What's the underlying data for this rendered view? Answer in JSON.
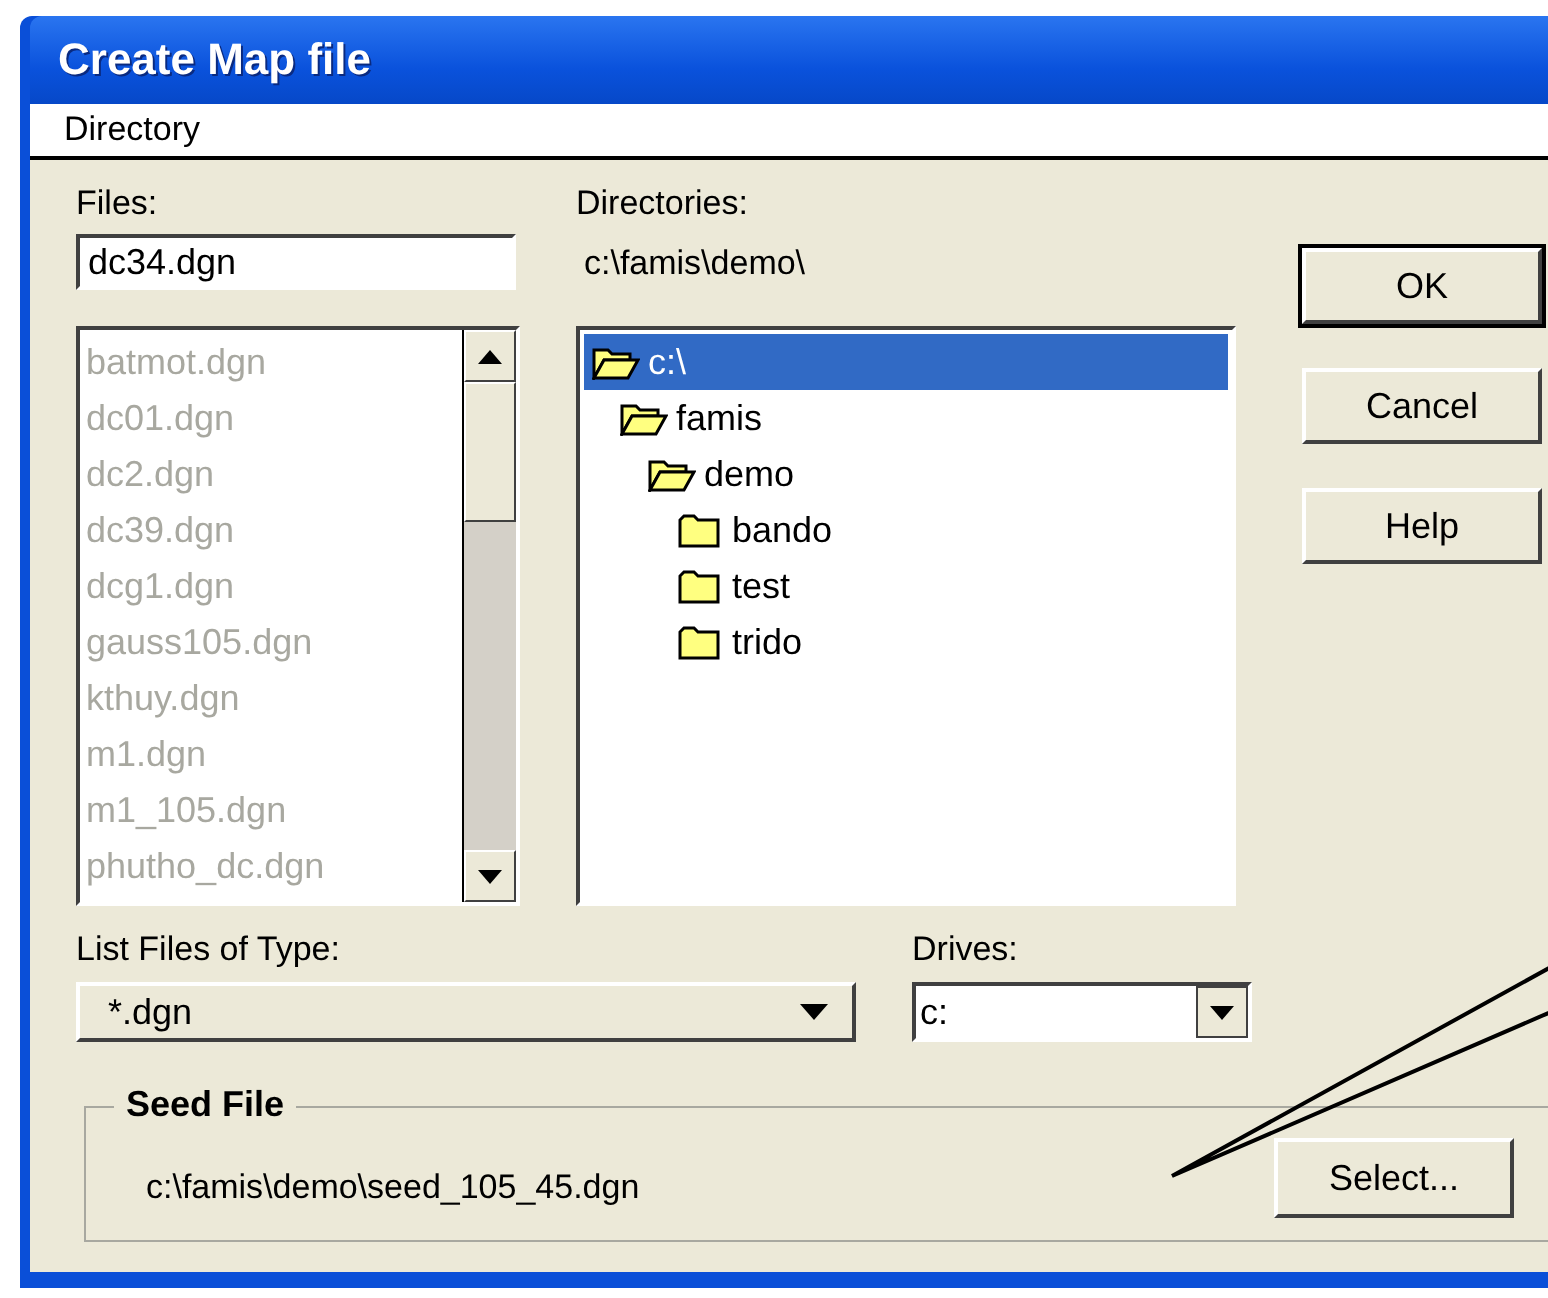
{
  "window": {
    "title": "Create Map file"
  },
  "menu": [
    {
      "label": "Directory"
    }
  ],
  "files": {
    "label": "Files:",
    "value": "dc34.dgn",
    "disabled": true,
    "items": [
      {
        "name": "batmot.dgn"
      },
      {
        "name": "dc01.dgn"
      },
      {
        "name": "dc2.dgn"
      },
      {
        "name": "dc39.dgn"
      },
      {
        "name": "dcg1.dgn"
      },
      {
        "name": "gauss105.dgn"
      },
      {
        "name": "kthuy.dgn"
      },
      {
        "name": "m1.dgn"
      },
      {
        "name": "m1_105.dgn"
      },
      {
        "name": "phutho_dc.dgn"
      }
    ]
  },
  "directories": {
    "label": "Directories:",
    "path": "c:\\famis\\demo\\",
    "tree": [
      {
        "name": "c:\\",
        "expanded": true,
        "selected": true,
        "children": [
          {
            "name": "famis",
            "expanded": true,
            "selected": false,
            "children": [
              {
                "name": "demo",
                "expanded": true,
                "selected": false,
                "children": [
                  {
                    "name": "bando",
                    "expanded": false,
                    "selected": false
                  },
                  {
                    "name": "test",
                    "expanded": false,
                    "selected": false
                  },
                  {
                    "name": "trido",
                    "expanded": false,
                    "selected": false
                  }
                ]
              }
            ]
          }
        ]
      }
    ]
  },
  "buttons": [
    {
      "label": "OK",
      "default": true
    },
    {
      "label": "Cancel",
      "default": false
    },
    {
      "label": "Help",
      "default": false
    }
  ],
  "file_type": {
    "label": "List Files of Type:",
    "value": "*.dgn"
  },
  "drives": {
    "label": "Drives:",
    "value": "c:"
  },
  "seed_file": {
    "title": "Seed File",
    "path": "c:\\famis\\demo\\seed_105_45.dgn",
    "button": "Select..."
  }
}
